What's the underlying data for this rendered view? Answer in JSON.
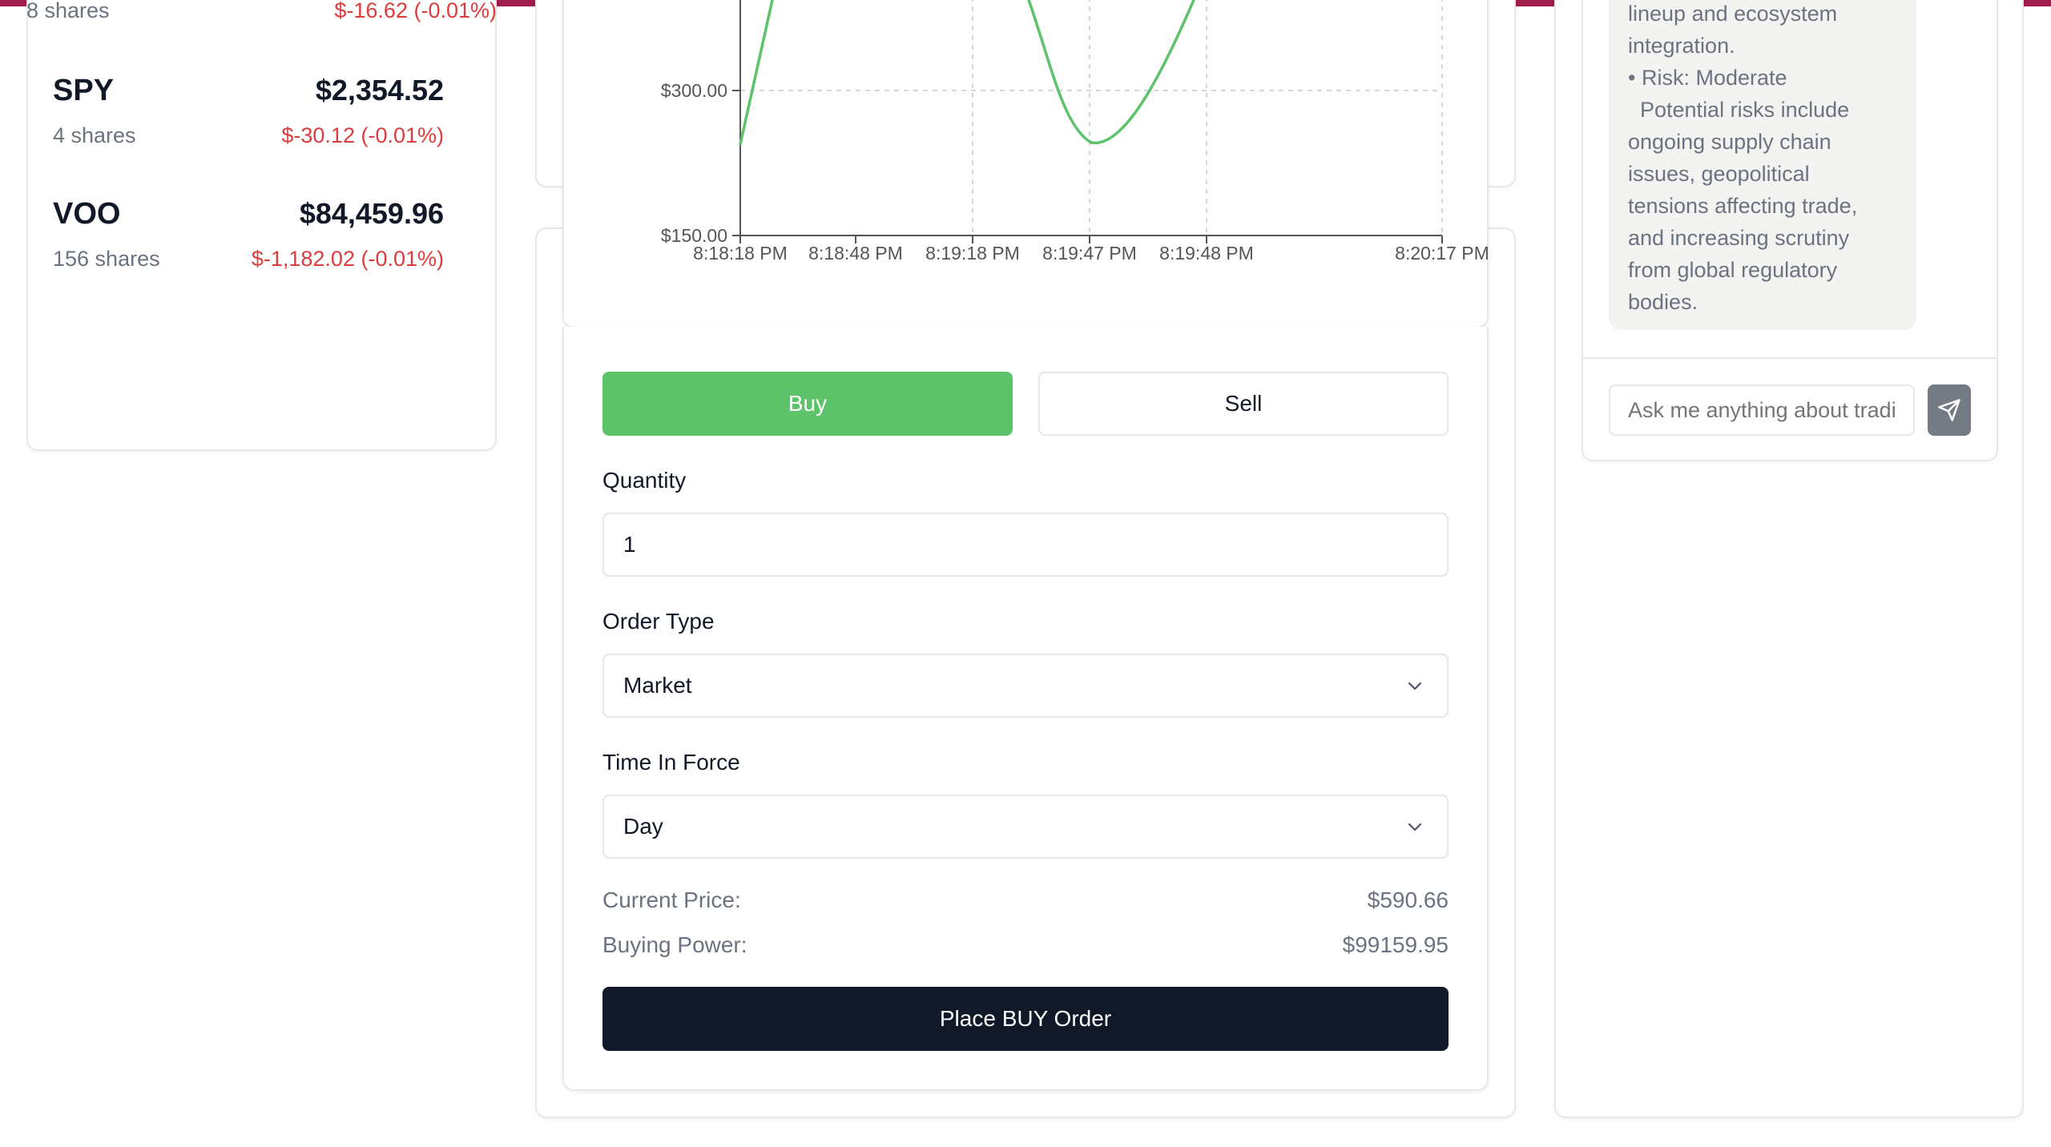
{
  "positions": [
    {
      "symbol": "",
      "shares": "8 shares",
      "value": "",
      "change": "$-16.62 (-0.01%)"
    },
    {
      "symbol": "SPY",
      "shares": "4 shares",
      "value": "$2,354.52",
      "change": "$-30.12 (-0.01%)"
    },
    {
      "symbol": "VOO",
      "shares": "156 shares",
      "value": "$84,459.96",
      "change": "$-1,182.02 (-0.01%)"
    }
  ],
  "chart_data": {
    "type": "line",
    "y_ticks": [
      "$150.00",
      "$300.00"
    ],
    "x_ticks": [
      "8:18:18 PM",
      "8:18:48 PM",
      "8:19:18 PM",
      "8:19:47 PM",
      "8:19:48 PM",
      "8:20:17 PM"
    ],
    "line_color": "#5dc36a",
    "grid": true
  },
  "trade": {
    "buy_label": "Buy",
    "sell_label": "Sell",
    "quantity_label": "Quantity",
    "quantity_value": "1",
    "order_type_label": "Order Type",
    "order_type_value": "Market",
    "tif_label": "Time In Force",
    "tif_value": "Day",
    "current_price_label": "Current Price:",
    "current_price_value": "$590.66",
    "buying_power_label": "Buying Power:",
    "buying_power_value": "$99159.95",
    "place_order_label": "Place BUY Order"
  },
  "chat": {
    "message_lines": [
      "lineup and ecosystem",
      "integration.",
      "• Risk: Moderate",
      "  Potential risks include",
      "ongoing supply chain",
      "issues, geopolitical",
      "tensions affecting trade,",
      "and increasing scrutiny",
      "from global regulatory",
      "bodies."
    ],
    "input_placeholder": "Ask me anything about trading..."
  },
  "colors": {
    "accent_green": "#5dc36a",
    "loss_red": "#dc3c3c",
    "dark": "#111827",
    "top_bar": "#9f1d4a"
  }
}
